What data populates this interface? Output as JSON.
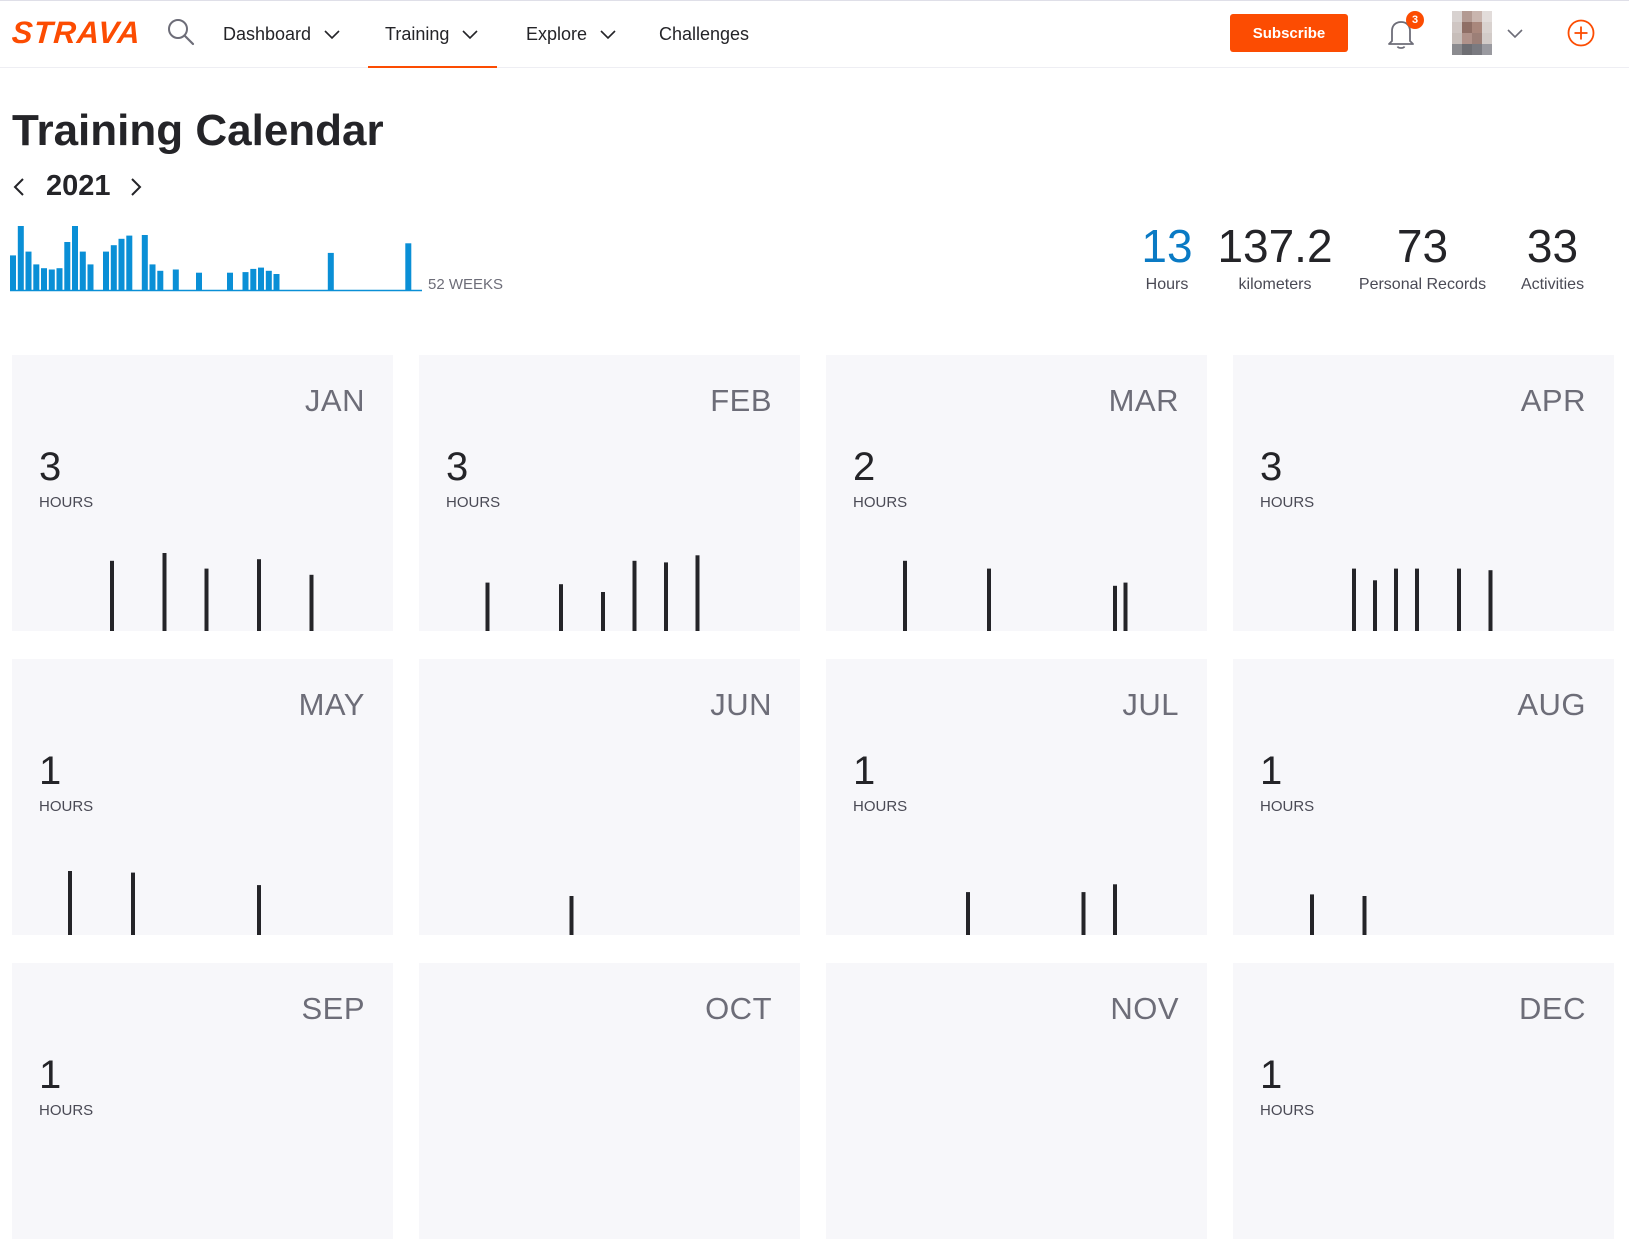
{
  "brand": {
    "name": "STRAVA",
    "color": "#fc4c02"
  },
  "nav": {
    "items": [
      {
        "label": "Dashboard",
        "has_dropdown": true,
        "active": false
      },
      {
        "label": "Training",
        "has_dropdown": true,
        "active": true
      },
      {
        "label": "Explore",
        "has_dropdown": true,
        "active": false
      },
      {
        "label": "Challenges",
        "has_dropdown": false,
        "active": false
      }
    ],
    "search_icon": "search-icon"
  },
  "header_actions": {
    "subscribe_label": "Subscribe",
    "notification_count": "3",
    "bell_icon": "bell-icon",
    "upload_icon": "plus-circle-icon"
  },
  "page": {
    "title": "Training Calendar",
    "year": "2021",
    "weeks_label": "52 WEEKS"
  },
  "stats": [
    {
      "value": "13",
      "label": "Hours",
      "highlight": true
    },
    {
      "value": "137.2",
      "label": "kilometers",
      "highlight": false
    },
    {
      "value": "73",
      "label": "Personal Records",
      "highlight": false
    },
    {
      "value": "33",
      "label": "Activities",
      "highlight": false
    }
  ],
  "chart_data": [
    {
      "type": "bar",
      "weeks_total": 52,
      "color": "#0a8fd6",
      "weekly_values": [
        0.54,
        1.0,
        0.6,
        0.4,
        0.34,
        0.32,
        0.34,
        0.75,
        1.0,
        0.6,
        0.4,
        0,
        0.6,
        0.7,
        0.8,
        0.85,
        0,
        0.86,
        0.4,
        0.3,
        0,
        0.32,
        0,
        0,
        0.27,
        0,
        0,
        0,
        0.27,
        0,
        0.28,
        0.33,
        0.35,
        0.3,
        0.25,
        0,
        0,
        0,
        0,
        0,
        0,
        0.58,
        0,
        0,
        0,
        0,
        0,
        0,
        0,
        0,
        0,
        0.73
      ],
      "ylim": [
        0,
        1
      ]
    },
    {
      "type": "bar",
      "months": [
        "JAN",
        "FEB",
        "MAR",
        "APR",
        "MAY",
        "JUN",
        "JUL",
        "AUG",
        "SEP",
        "OCT",
        "NOV",
        "DEC"
      ],
      "hours": [
        "3",
        "3",
        "2",
        "3",
        "1",
        "",
        "1",
        "1",
        "1",
        "",
        "",
        "1"
      ],
      "hours_unit": "HOURS",
      "ylim": [
        0,
        1
      ],
      "day_bars": [
        [
          {
            "day": 7,
            "v": 0.9
          },
          {
            "day": 12,
            "v": 1.0
          },
          {
            "day": 16,
            "v": 0.8
          },
          {
            "day": 21,
            "v": 0.92
          },
          {
            "day": 26,
            "v": 0.72
          }
        ],
        [
          {
            "day": 4,
            "v": 0.62
          },
          {
            "day": 11,
            "v": 0.6
          },
          {
            "day": 15,
            "v": 0.5
          },
          {
            "day": 18,
            "v": 0.9
          },
          {
            "day": 21,
            "v": 0.88
          },
          {
            "day": 24,
            "v": 0.97
          }
        ],
        [
          {
            "day": 5,
            "v": 0.9
          },
          {
            "day": 13,
            "v": 0.8
          },
          {
            "day": 25,
            "v": 0.58
          },
          {
            "day": 26,
            "v": 0.62
          }
        ],
        [
          {
            "day": 9,
            "v": 0.8
          },
          {
            "day": 11,
            "v": 0.65
          },
          {
            "day": 13,
            "v": 0.8
          },
          {
            "day": 15,
            "v": 0.8
          },
          {
            "day": 19,
            "v": 0.8
          },
          {
            "day": 22,
            "v": 0.78
          }
        ],
        [
          {
            "day": 3,
            "v": 0.82
          },
          {
            "day": 9,
            "v": 0.8
          },
          {
            "day": 21,
            "v": 0.64
          }
        ],
        [
          {
            "day": 12,
            "v": 0.5
          }
        ],
        [
          {
            "day": 11,
            "v": 0.55
          },
          {
            "day": 22,
            "v": 0.55
          },
          {
            "day": 25,
            "v": 0.65
          }
        ],
        [
          {
            "day": 5,
            "v": 0.52
          },
          {
            "day": 10,
            "v": 0.5
          }
        ],
        [],
        [],
        [],
        []
      ]
    }
  ]
}
